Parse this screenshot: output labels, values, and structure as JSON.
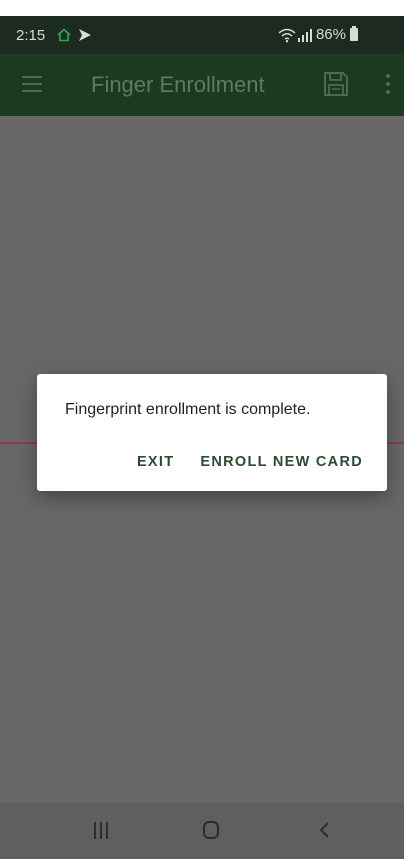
{
  "status_bar": {
    "time": "2:15",
    "battery_percent": "86%",
    "icons": [
      "home-icon",
      "cast-icon",
      "wifi-icon",
      "signal-icon",
      "battery-icon"
    ]
  },
  "app_bar": {
    "title": "Finger Enrollment",
    "icons": [
      "menu-icon",
      "save-icon",
      "more-vert-icon"
    ]
  },
  "dialog": {
    "message": "Fingerprint enrollment is complete.",
    "buttons": {
      "exit": "EXIT",
      "enroll_new_card": "ENROLL NEW CARD"
    }
  },
  "nav_bar": {
    "icons": [
      "recent-apps-icon",
      "home-icon",
      "back-icon"
    ]
  },
  "colors": {
    "app_bar": "#1a3a21",
    "status_bar": "#1c2a1f",
    "scrim": "#676767",
    "dialog_button_text": "#2e4a33",
    "accent_line": "#8a3a55"
  }
}
